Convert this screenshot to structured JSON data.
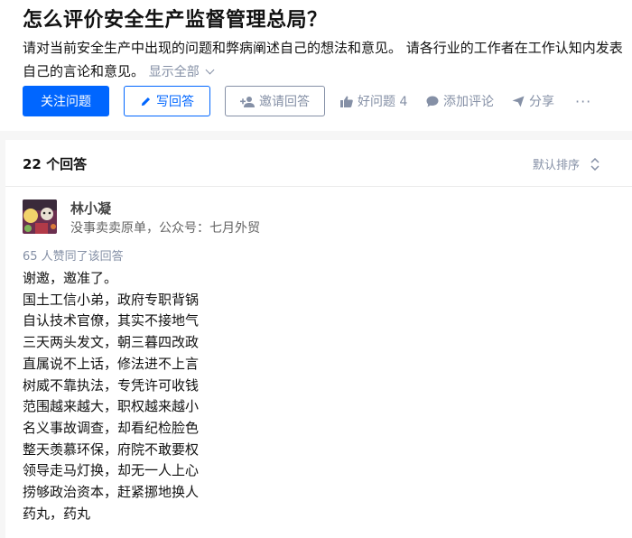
{
  "question": {
    "title": "怎么评价安全生产监督管理总局？",
    "description": "请对当前安全生产中出现的问题和弊病阐述自己的想法和意见。 请各行业的工作者在工作认知内发表自己的言论和意见。",
    "show_all": "显示全部"
  },
  "actions": {
    "follow": "关注问题",
    "write": "写回答",
    "invite": "邀请回答",
    "good_question": "好问题 4",
    "comment": "添加评论",
    "share": "分享",
    "more": "···"
  },
  "answers": {
    "count_label": "22 个回答",
    "sort_label": "默认排序"
  },
  "answer": {
    "author_name": "林小凝",
    "author_bio": "没事卖卖原单，公众号：七月外贸",
    "upvote_text": "65 人赞同了该回答",
    "lines": [
      "谢邀，邀准了。",
      "国土工信小弟，政府专职背锅",
      "自认技术官僚，其实不接地气",
      "三天两头发文，朝三暮四改政",
      "直属说不上话，修法进不上言",
      "树威不靠执法，专凭许可收钱",
      "范围越来越大，职权越来越小",
      "名义事故调查，却看纪检脸色",
      "整天羡慕环保，府院不敢要权",
      "领导走马灯换，却无一人上心",
      "捞够政治资本，赶紧挪地换人",
      "药丸，药丸"
    ]
  },
  "colors": {
    "brand": "#0066ff",
    "muted": "#8590a6",
    "text": "#121212",
    "background": "#f6f6f6"
  },
  "icons": [
    "pen-icon",
    "invite-user-icon",
    "thumbs-up-icon",
    "comment-icon",
    "share-icon",
    "sort-arrows-icon",
    "chevron-down-icon"
  ]
}
